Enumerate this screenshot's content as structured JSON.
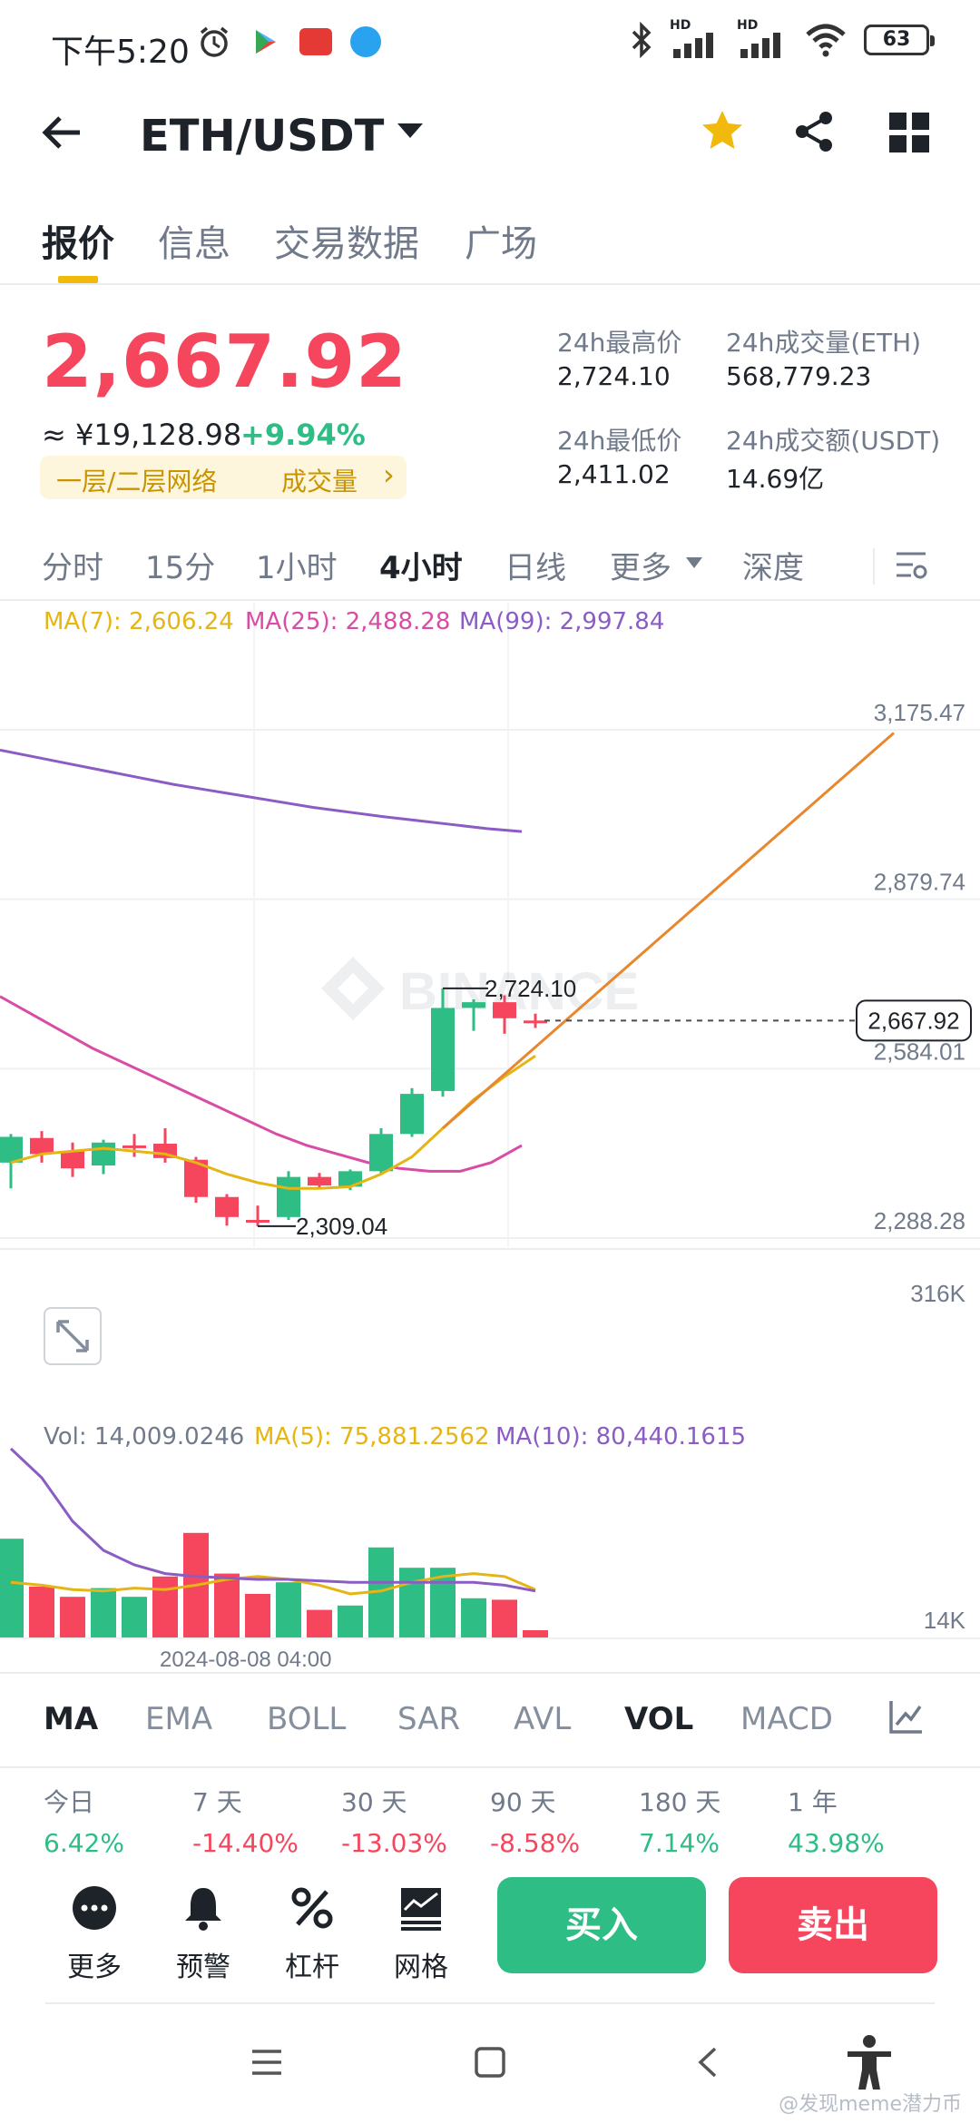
{
  "status_bar": {
    "time": "下午5:20",
    "battery": "63",
    "hd1": "HD",
    "hd2": "HD"
  },
  "header": {
    "pair": "ETH/USDT"
  },
  "tabs": [
    "报价",
    "信息",
    "交易数据",
    "广场"
  ],
  "price": {
    "last": "2,667.92",
    "cny": "≈ ¥19,128.98",
    "change": "+9.94%",
    "tag_network": "一层/二层网络",
    "tag_volume": "成交量",
    "tag_arrow": "›"
  },
  "stats": {
    "high_label": "24h最高价",
    "high": "2,724.10",
    "low_label": "24h最低价",
    "low": "2,411.02",
    "vol_label": "24h成交量(ETH)",
    "vol": "568,779.23",
    "amt_label": "24h成交额(USDT)",
    "amt": "14.69亿"
  },
  "intervals": [
    "分时",
    "15分",
    "1小时",
    "4小时",
    "日线",
    "更多",
    "深度"
  ],
  "chart_data": {
    "type": "candlestick",
    "ma_legend": {
      "ma7": "MA(7): 2,606.24",
      "ma25": "MA(25): 2,488.28",
      "ma99": "MA(99): 2,997.84"
    },
    "y_ticks": [
      "3,175.47",
      "2,879.74",
      "2,584.01",
      "2,288.28"
    ],
    "high_label": "2,724.10",
    "low_label": "2,309.04",
    "last_price_label": "2,667.92",
    "watermark": "BINANCE",
    "ylim": [
      2288.28,
      3175.47
    ],
    "candles": [
      {
        "o": 2420,
        "h": 2470,
        "c": 2465,
        "l": 2375
      },
      {
        "o": 2463,
        "h": 2475,
        "c": 2435,
        "l": 2420
      },
      {
        "o": 2440,
        "h": 2455,
        "c": 2410,
        "l": 2395
      },
      {
        "o": 2415,
        "h": 2460,
        "c": 2455,
        "l": 2400
      },
      {
        "o": 2450,
        "h": 2470,
        "c": 2448,
        "l": 2430
      },
      {
        "o": 2453,
        "h": 2480,
        "c": 2428,
        "l": 2420
      },
      {
        "o": 2425,
        "h": 2430,
        "c": 2360,
        "l": 2350
      },
      {
        "o": 2360,
        "h": 2365,
        "c": 2325,
        "l": 2310
      },
      {
        "o": 2320,
        "h": 2345,
        "c": 2318,
        "l": 2309.04
      },
      {
        "o": 2325,
        "h": 2405,
        "c": 2395,
        "l": 2320
      },
      {
        "o": 2395,
        "h": 2402,
        "c": 2380,
        "l": 2375
      },
      {
        "o": 2378,
        "h": 2408,
        "c": 2405,
        "l": 2372
      },
      {
        "o": 2405,
        "h": 2480,
        "c": 2470,
        "l": 2400
      },
      {
        "o": 2470,
        "h": 2550,
        "c": 2540,
        "l": 2465
      },
      {
        "o": 2545,
        "h": 2724.1,
        "c": 2690,
        "l": 2535
      },
      {
        "o": 2690,
        "h": 2705,
        "c": 2700,
        "l": 2650
      },
      {
        "o": 2700,
        "h": 2712,
        "c": 2672,
        "l": 2645
      },
      {
        "o": 2668,
        "h": 2680,
        "c": 2667.92,
        "l": 2655
      }
    ],
    "ma7": [
      2420,
      2435,
      2440,
      2445,
      2440,
      2435,
      2420,
      2400,
      2385,
      2375,
      2375,
      2378,
      2400,
      2430,
      2480,
      2530,
      2570,
      2606.24,
      2800,
      3170
    ],
    "ma25": [
      2710,
      2680,
      2650,
      2620,
      2595,
      2570,
      2545,
      2520,
      2495,
      2470,
      2450,
      2435,
      2420,
      2410,
      2405,
      2405,
      2420,
      2450
    ],
    "ma99": [
      3140,
      3128,
      3116,
      3104,
      3092,
      3080,
      3070,
      3060,
      3050,
      3040,
      3032,
      3024,
      3017,
      3010,
      3003,
      2997.84
    ],
    "volume": {
      "legend": {
        "vol": "Vol: 14,009.0246",
        "ma5": "MA(5): 75,881.2562",
        "ma10": "MA(10): 80,440.1615"
      },
      "ticks": [
        "316K",
        "14K"
      ],
      "date_label": "2024-08-08 04:00",
      "bars": [
        {
          "v": 68,
          "up": true
        },
        {
          "v": 35,
          "up": false
        },
        {
          "v": 28,
          "up": false
        },
        {
          "v": 34,
          "up": true
        },
        {
          "v": 28,
          "up": true
        },
        {
          "v": 42,
          "up": false
        },
        {
          "v": 72,
          "up": false
        },
        {
          "v": 44,
          "up": false
        },
        {
          "v": 30,
          "up": false
        },
        {
          "v": 38,
          "up": true
        },
        {
          "v": 19,
          "up": false
        },
        {
          "v": 22,
          "up": true
        },
        {
          "v": 62,
          "up": true
        },
        {
          "v": 48,
          "up": true
        },
        {
          "v": 48,
          "up": true
        },
        {
          "v": 27,
          "up": true
        },
        {
          "v": 26,
          "up": false
        },
        {
          "v": 5,
          "up": false
        }
      ],
      "ma5": [
        38,
        36,
        33,
        32,
        34,
        33,
        36,
        40,
        42,
        40,
        36,
        30,
        32,
        38,
        42,
        44,
        42,
        33
      ],
      "ma10": [
        130,
        110,
        80,
        60,
        50,
        44,
        42,
        41,
        40,
        40,
        39,
        38,
        38,
        38,
        38,
        38,
        36,
        32
      ]
    }
  },
  "indicator_tabs": [
    "MA",
    "EMA",
    "BOLL",
    "SAR",
    "AVL",
    "VOL",
    "MACD"
  ],
  "performance": [
    {
      "label": "今日",
      "value": "6.42%"
    },
    {
      "label": "7 天",
      "value": "-14.40%"
    },
    {
      "label": "30 天",
      "value": "-13.03%"
    },
    {
      "label": "90 天",
      "value": "-8.58%"
    },
    {
      "label": "180 天",
      "value": "7.14%"
    },
    {
      "label": "1 年",
      "value": "43.98%"
    }
  ],
  "actions": [
    "更多",
    "预警",
    "杠杆",
    "网格"
  ],
  "buy_label": "买入",
  "sell_label": "卖出",
  "watermark_bottom": "@发现meme潜力币",
  "colors": {
    "up": "#2ebd85",
    "down": "#f6465d",
    "ma7": "#e5b513",
    "ma25": "#d94ca6",
    "ma99": "#8a5cc4",
    "brand": "#f0b90b",
    "orange_line": "#e8872e"
  }
}
